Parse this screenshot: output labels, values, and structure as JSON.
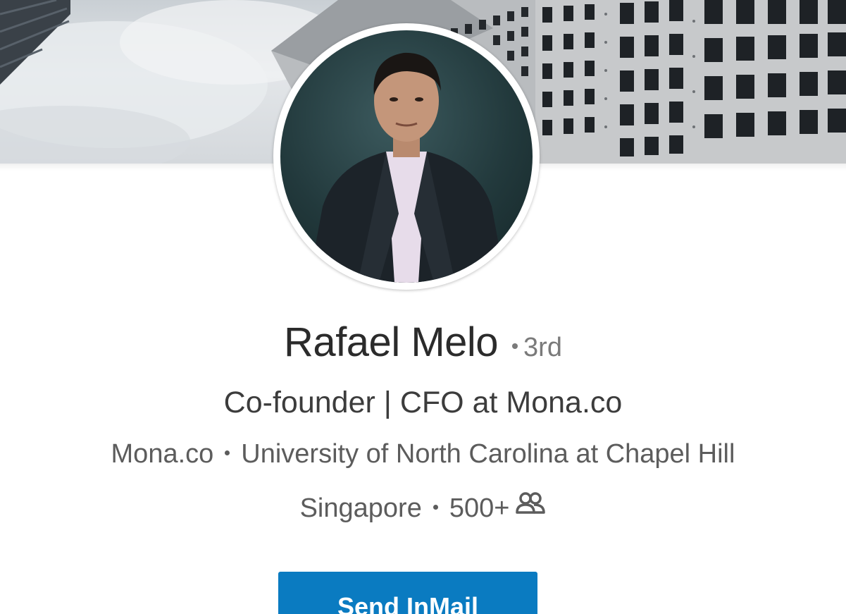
{
  "profile": {
    "name": "Rafael Melo",
    "degree": "3rd",
    "headline": "Co-founder | CFO at Mona.co",
    "company": "Mona.co",
    "school": "University of North Carolina at Chapel Hill",
    "location": "Singapore",
    "connections": "500+"
  },
  "actions": {
    "send_inmail_label": "Send InMail"
  },
  "icons": {
    "connections": "connections-icon"
  },
  "colors": {
    "primary_button": "#0a7bc1",
    "name_text": "#2b2b2b",
    "secondary_text": "#5c5c5c"
  }
}
